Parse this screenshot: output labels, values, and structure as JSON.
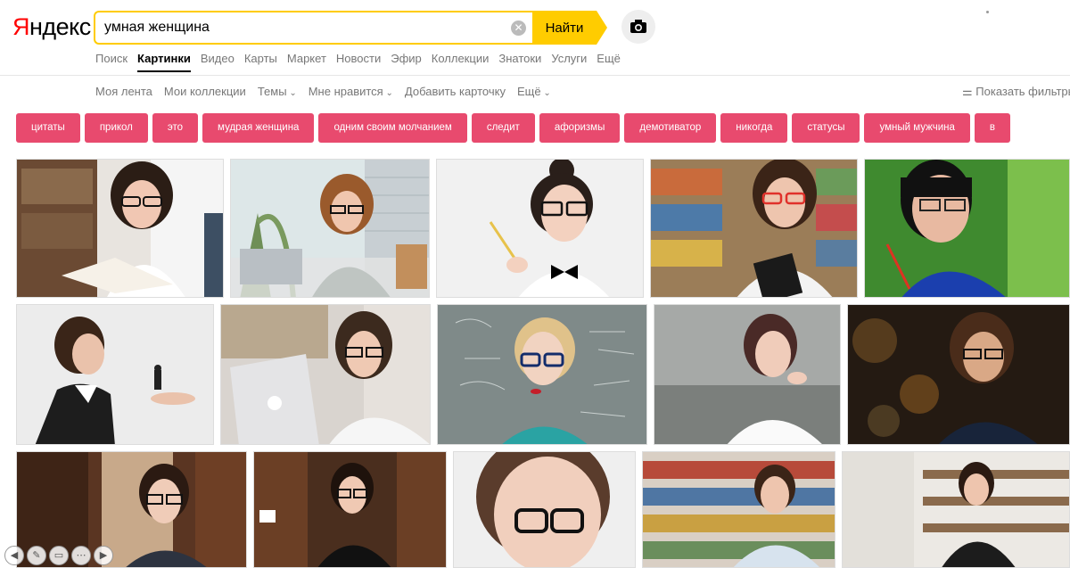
{
  "logo": {
    "first": "Я",
    "rest": "ндекс"
  },
  "search": {
    "query": "умная женщина",
    "button_label": "Найти"
  },
  "services": [
    "Поиск",
    "Картинки",
    "Видео",
    "Карты",
    "Маркет",
    "Новости",
    "Эфир",
    "Коллекции",
    "Знатоки",
    "Услуги",
    "Ещё"
  ],
  "subnav": {
    "feed": "Моя лента",
    "collections": "Мои коллекции",
    "topics": "Темы",
    "likes": "Мне нравится",
    "add_card": "Добавить карточку",
    "more": "Ещё",
    "filters": "Показать фильтры"
  },
  "chips": [
    "цитаты",
    "прикол",
    "это",
    "мудрая женщина",
    "одним своим молчанием",
    "следит",
    "афоризмы",
    "демотиватор",
    "никогда",
    "статусы",
    "умный мужчина",
    "в"
  ],
  "colors": {
    "accent": "#ffcc00",
    "chip": "#e84a6e",
    "logo_red": "#ff0000"
  }
}
